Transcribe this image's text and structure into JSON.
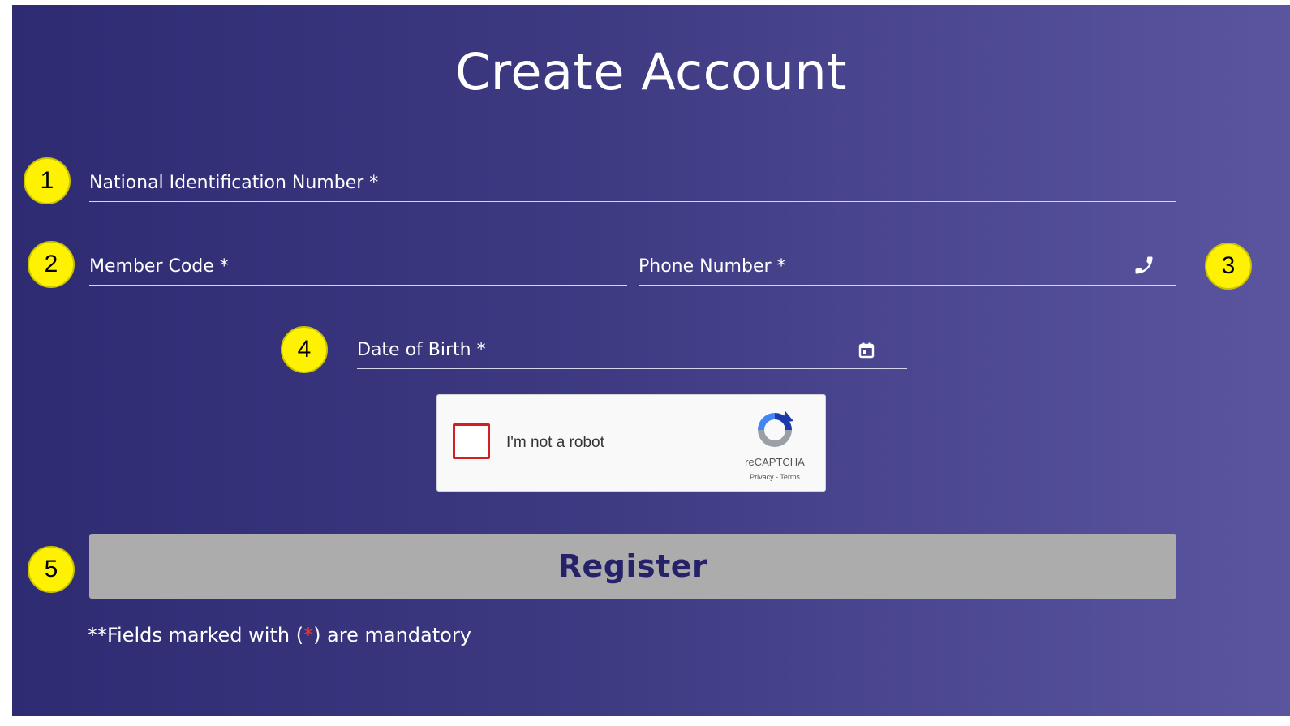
{
  "page": {
    "title": "Create Account"
  },
  "form": {
    "national_id": {
      "label": "National Identification Number *",
      "value": ""
    },
    "member_code": {
      "label": "Member Code *",
      "value": ""
    },
    "phone_number": {
      "label": "Phone Number *",
      "value": "",
      "icon": "phone-icon"
    },
    "date_of_birth": {
      "label": "Date of Birth *",
      "value": "",
      "icon": "calendar-icon"
    }
  },
  "captcha": {
    "checkbox_label": "I'm not a robot",
    "brand": "reCAPTCHA",
    "links": "Privacy - Terms",
    "checked": false
  },
  "register": {
    "label": "Register"
  },
  "footer_note": {
    "prefix": "**Fields marked with (",
    "star": "*",
    "suffix": ") are mandatory"
  },
  "markers": [
    "1",
    "2",
    "3",
    "4",
    "5"
  ],
  "colors": {
    "background_start": "#2e2b73",
    "background_end": "#5b55a0",
    "button": "#acacac",
    "button_text": "#25226a",
    "marker": "#fff200",
    "required_star": "#e23a3a",
    "captcha_checkbox_border": "#d21f1f"
  }
}
